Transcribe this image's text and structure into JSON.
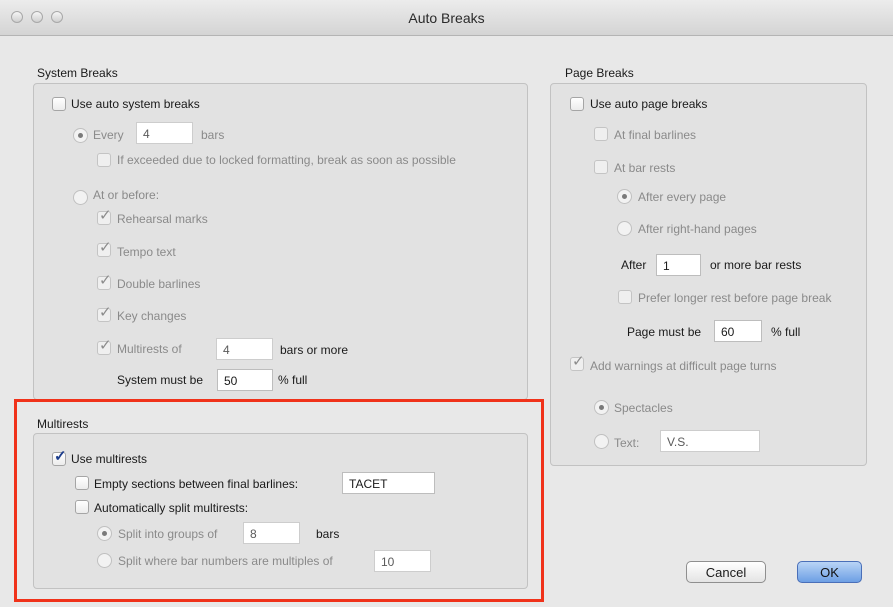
{
  "window": {
    "title": "Auto Breaks"
  },
  "system_breaks": {
    "title": "System Breaks",
    "use_auto": {
      "label": "Use auto system breaks",
      "checked": false
    },
    "every": {
      "label": "Every",
      "value": "4",
      "suffix": "bars"
    },
    "if_exceeded": {
      "label": "If exceeded due to locked formatting, break as soon as possible"
    },
    "at_or_before": {
      "label": "At or before:"
    },
    "rehearsal_marks": {
      "label": "Rehearsal marks"
    },
    "tempo_text": {
      "label": "Tempo text"
    },
    "double_barlines": {
      "label": "Double barlines"
    },
    "key_changes": {
      "label": "Key changes"
    },
    "multirests_of": {
      "label": "Multirests of",
      "value": "4",
      "suffix": "bars or more"
    },
    "system_must_be": {
      "label": "System must be",
      "value": "50",
      "suffix": "% full"
    }
  },
  "multirests": {
    "title": "Multirests",
    "use_multirests": {
      "label": "Use multirests",
      "checked": true
    },
    "empty_sections": {
      "label": "Empty sections between final barlines:",
      "value": "TACET"
    },
    "auto_split": {
      "label": "Automatically split multirests:"
    },
    "split_groups": {
      "label": "Split into groups of",
      "value": "8",
      "suffix": "bars"
    },
    "split_where": {
      "label": "Split where bar numbers are multiples of",
      "value": "10"
    }
  },
  "page_breaks": {
    "title": "Page Breaks",
    "use_auto": {
      "label": "Use auto page breaks",
      "checked": false
    },
    "final_barlines": {
      "label": "At final barlines"
    },
    "bar_rests": {
      "label": "At bar rests"
    },
    "after_every_page": {
      "label": "After every page"
    },
    "after_right_hand": {
      "label": "After right-hand pages"
    },
    "after_rests": {
      "label": "After",
      "value": "1",
      "suffix": "or more bar rests"
    },
    "prefer_longer": {
      "label": "Prefer longer rest before page break"
    },
    "page_must_be": {
      "label": "Page must be",
      "value": "60",
      "suffix": "% full"
    },
    "warnings": {
      "label": "Add warnings at difficult page turns"
    },
    "spectacles": {
      "label": "Spectacles"
    },
    "text": {
      "label": "Text:",
      "value": "V.S."
    }
  },
  "buttons": {
    "cancel": "Cancel",
    "ok": "OK"
  },
  "highlight_color": "#f0321a"
}
